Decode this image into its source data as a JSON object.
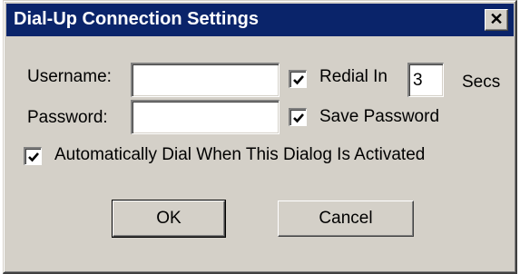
{
  "window": {
    "title": "Dial-Up Connection Settings",
    "close_glyph": "✕"
  },
  "form": {
    "username_label": "Username:",
    "username_value": "",
    "password_label": "Password:",
    "password_value": "",
    "redial_label": "Redial In",
    "redial_checked": true,
    "redial_value": "3",
    "redial_unit": "Secs",
    "save_password_label": "Save Password",
    "save_password_checked": true,
    "auto_dial_label": "Automatically Dial When This Dialog Is Activated",
    "auto_dial_checked": true
  },
  "buttons": {
    "ok": "OK",
    "cancel": "Cancel"
  },
  "colors": {
    "titlebar": "#0a246a",
    "face": "#d4d0c8"
  },
  "icons": {
    "close": "close-icon",
    "check": "checkmark-icon"
  }
}
